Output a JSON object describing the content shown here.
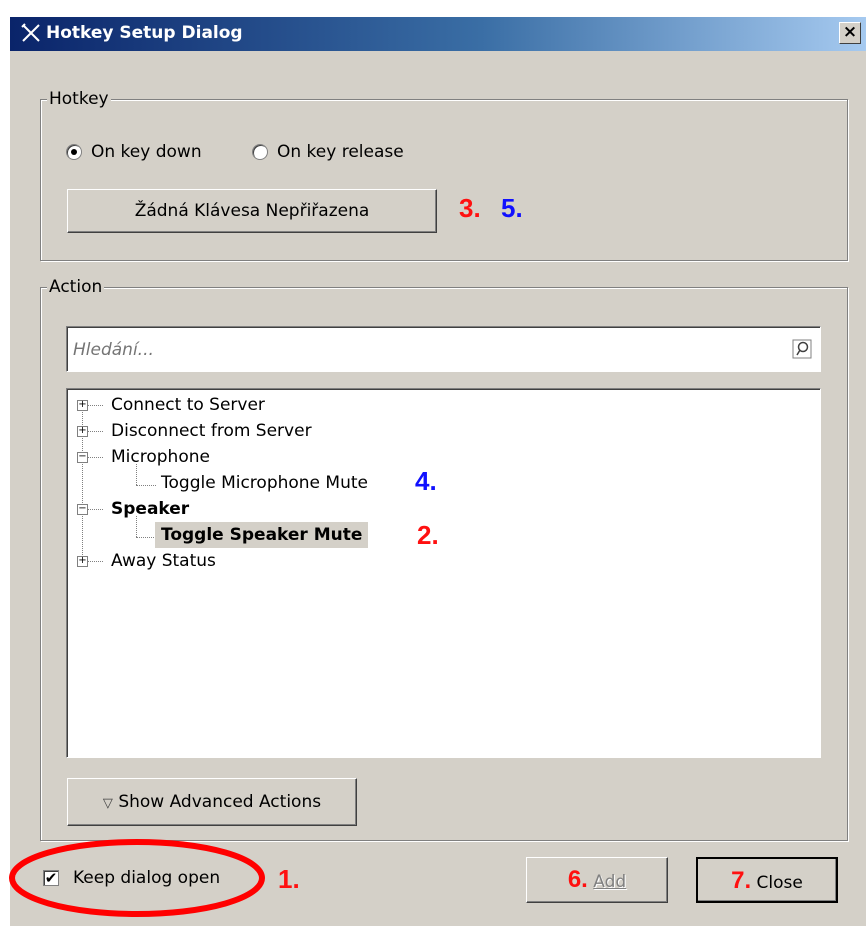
{
  "window": {
    "title": "Hotkey Setup Dialog",
    "close_glyph": "×"
  },
  "hotkey_group": {
    "label": "Hotkey",
    "radio_down_label": "On key down",
    "radio_release_label": "On key release",
    "selected": "On key down",
    "assign_button_label": "Žádná Klávesa Nepřiřazena"
  },
  "action_group": {
    "label": "Action",
    "search_placeholder": "Hledání...",
    "tree": [
      {
        "label": "Connect to Server",
        "expander": "+"
      },
      {
        "label": "Disconnect from Server",
        "expander": "+"
      },
      {
        "label": "Microphone",
        "expander": "−"
      },
      {
        "label": "Toggle Microphone Mute"
      },
      {
        "label": "Speaker",
        "expander": "−"
      },
      {
        "label": "Toggle Speaker Mute"
      },
      {
        "label": "Away Status",
        "expander": "+"
      }
    ],
    "advanced_button_label": "Show Advanced Actions",
    "advanced_arrow": "▽"
  },
  "footer": {
    "keep_open_label": "Keep dialog open",
    "keep_open_checked": true,
    "check_glyph": "✔",
    "add_label": "Add",
    "close_label": "Close"
  },
  "annotations": {
    "n1": "1.",
    "n2": "2.",
    "n3": "3.",
    "n4": "4.",
    "n5": "5.",
    "n6": "6.",
    "n7": "7.",
    "red": "#ff1010",
    "blue": "#1010ff",
    "circle_color": "#ff0000"
  }
}
